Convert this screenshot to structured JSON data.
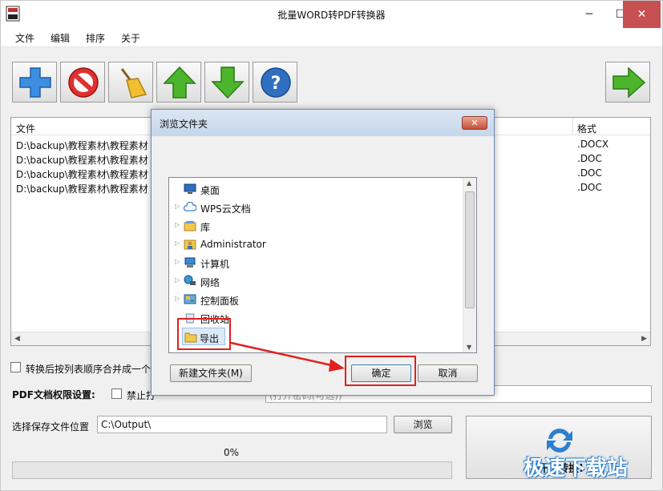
{
  "window": {
    "title": "批量WORD转PDF转换器",
    "min": "─",
    "max": "☐",
    "close": "✕"
  },
  "menu": [
    "文件",
    "编辑",
    "排序",
    "关于"
  ],
  "list": {
    "headers": {
      "file": "文件",
      "format": "格式"
    },
    "rows": [
      {
        "path": "D:\\backup\\教程素材\\教程素材",
        "format": ".DOCX"
      },
      {
        "path": "D:\\backup\\教程素材\\教程素材",
        "format": ".DOC"
      },
      {
        "path": "D:\\backup\\教程素材\\教程素材",
        "format": ".DOC"
      },
      {
        "path": "D:\\backup\\教程素材\\教程素材",
        "format": ".DOC"
      }
    ]
  },
  "options": {
    "merge_label": "转换后按列表顺序合并成一个",
    "pdf_perm_label": "PDF文档权限设置:",
    "forbid_print_label": "禁止打",
    "password_placeholder": "(打开密码(可选))"
  },
  "save": {
    "label": "选择保存文件位置",
    "path": "C:\\Output\\",
    "browse": "浏览"
  },
  "progress": {
    "text": "0%",
    "value": 0
  },
  "start": {
    "label": "开始转换!"
  },
  "watermark": "极速下载站",
  "dialog": {
    "title": "浏览文件夹",
    "close": "✕",
    "tree": [
      {
        "label": "桌面",
        "icon": "desktop-icon",
        "expander": ""
      },
      {
        "label": "WPS云文档",
        "icon": "cloud-icon",
        "expander": "▷"
      },
      {
        "label": "库",
        "icon": "library-icon",
        "expander": "▷"
      },
      {
        "label": "Administrator",
        "icon": "user-folder-icon",
        "expander": "▷"
      },
      {
        "label": "计算机",
        "icon": "computer-icon",
        "expander": "▷"
      },
      {
        "label": "网络",
        "icon": "network-icon",
        "expander": "▷"
      },
      {
        "label": "控制面板",
        "icon": "control-panel-icon",
        "expander": "▷"
      },
      {
        "label": "回收站",
        "icon": "recycle-bin-icon",
        "expander": ""
      },
      {
        "label": "导出",
        "icon": "folder-icon",
        "expander": ""
      }
    ],
    "new_folder": "新建文件夹(M)",
    "ok": "确定",
    "cancel": "取消"
  },
  "colors": {
    "annotation": "#e02020",
    "close_red": "#c75050"
  }
}
